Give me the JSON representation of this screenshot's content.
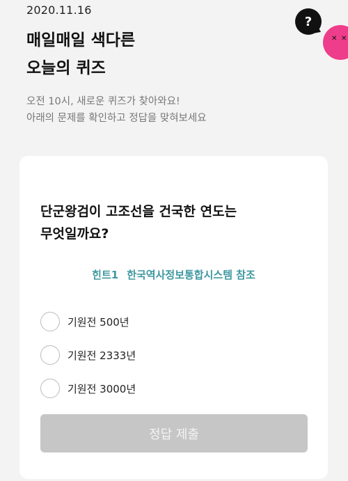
{
  "header": {
    "date": "2020.11.16",
    "headline_line1": "매일매일 색다른",
    "headline_line2": "오늘의 퀴즈",
    "subtext_line1": "오전 10시, 새로운 퀴즈가 찾아와요!",
    "subtext_line2": "아래의 문제를 확인하고 정답을 맞혀보세요"
  },
  "mascot": {
    "bubble_text": "?",
    "color": "#ee3d8a"
  },
  "quiz": {
    "question_line1": "단군왕검이 고조선을 건국한 연도는",
    "question_line2": "무엇일까요?",
    "hint_label": "힌트1",
    "hint_text": "한국역사정보통합시스템 참조",
    "options": [
      {
        "label": "기원전 500년"
      },
      {
        "label": "기원전 2333년"
      },
      {
        "label": "기원전 3000년"
      }
    ],
    "submit_label": "정답 제출"
  },
  "colors": {
    "accent": "#3f98a0",
    "button_disabled": "#c6c6c6",
    "background": "#f3f3f3"
  }
}
